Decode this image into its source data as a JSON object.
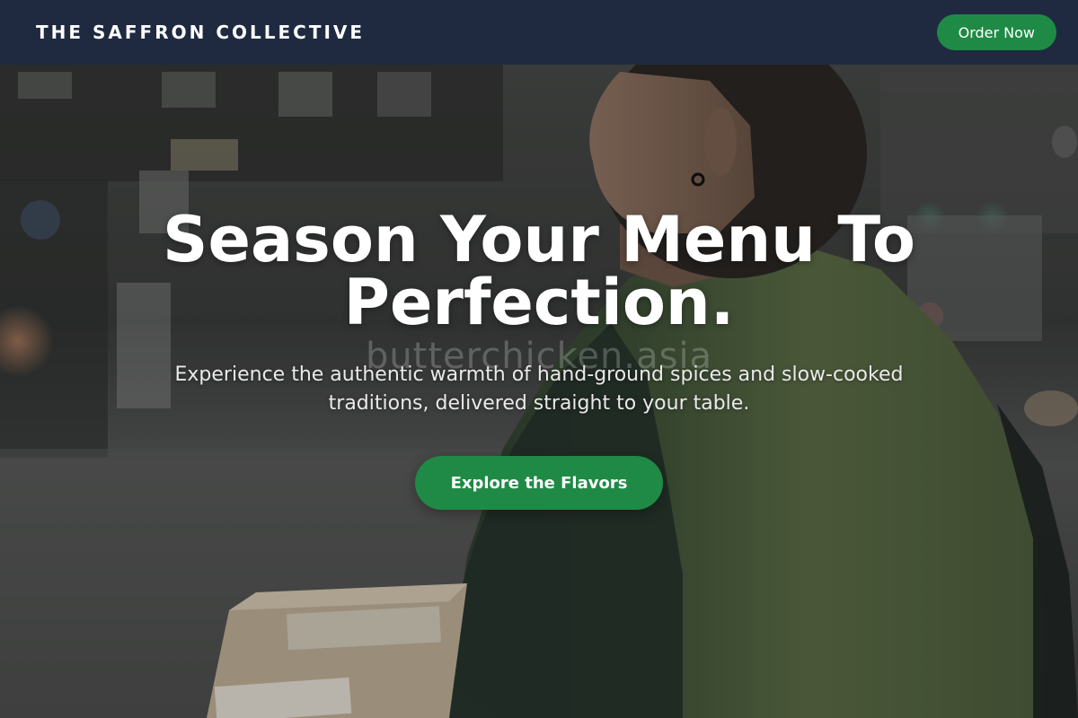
{
  "nav": {
    "brand": "THE SAFFRON COLLECTIVE",
    "order_label": "Order Now"
  },
  "hero": {
    "headline": "Season Your Menu To Perfection.",
    "subhead": "Experience the authentic warmth of hand-ground spices and slow-cooked traditions, delivered straight to your table.",
    "cta_label": "Explore the Flavors",
    "watermark": "butterchicken.asia"
  },
  "colors": {
    "nav_bg": "#1f2a40",
    "accent_green": "#1f8a46",
    "text_white": "#ffffff"
  },
  "icons": []
}
